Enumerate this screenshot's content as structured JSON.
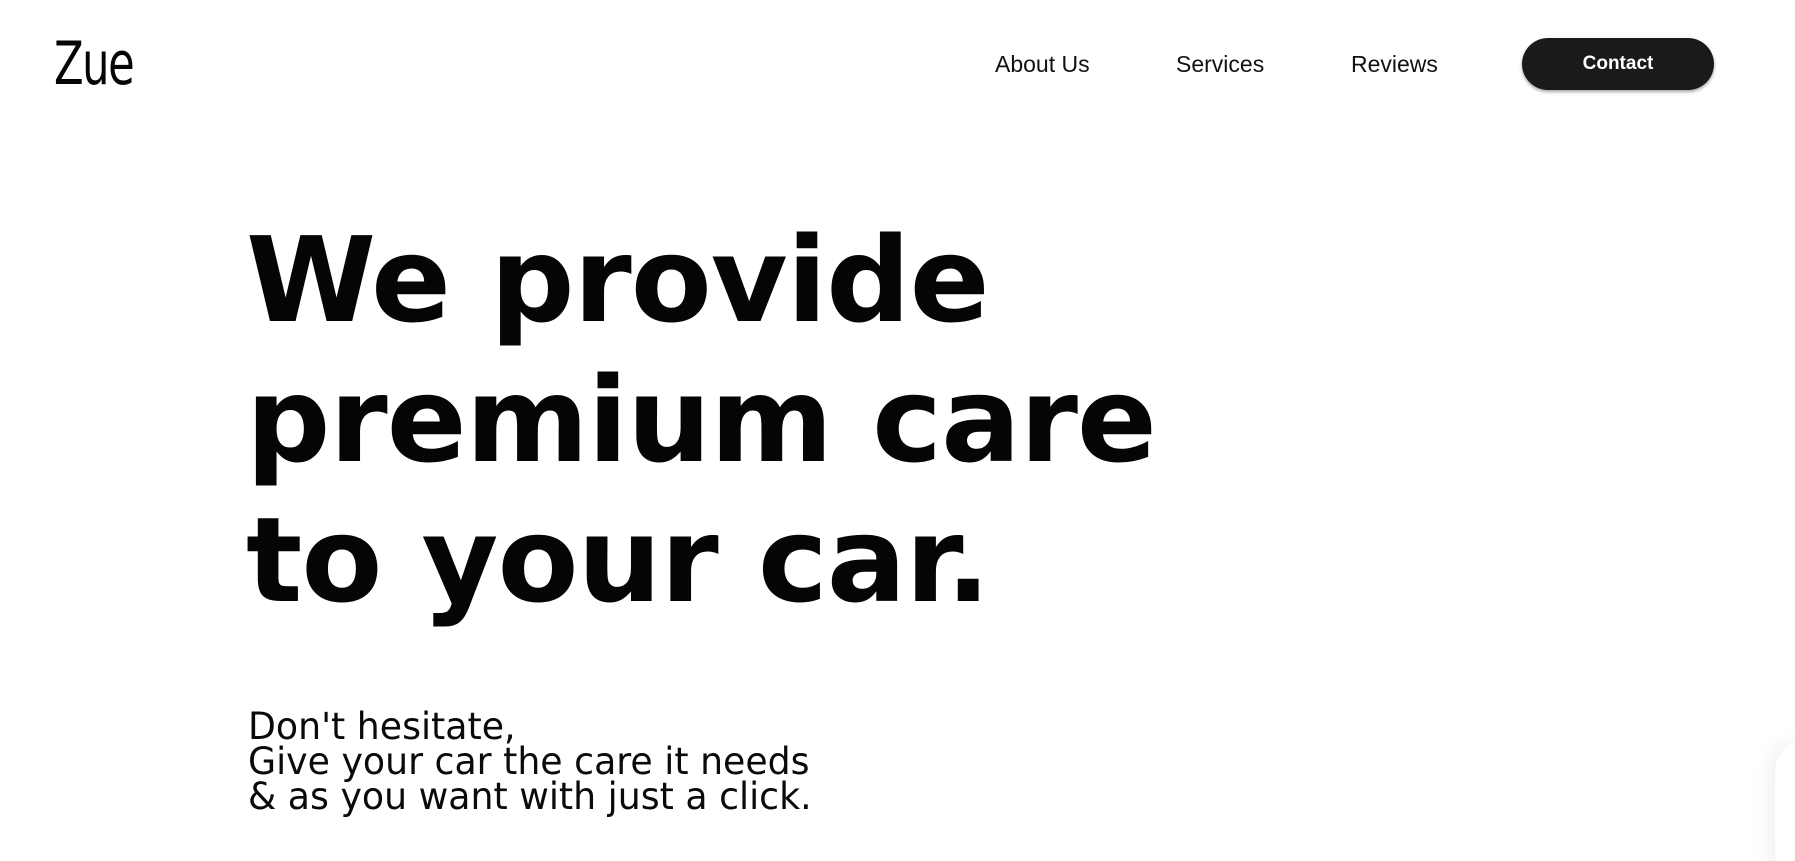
{
  "header": {
    "logo": "Zue",
    "nav": {
      "about": "About Us",
      "services": "Services",
      "reviews": "Reviews"
    },
    "contact_label": "Contact"
  },
  "hero": {
    "title_lines": [
      "We provide",
      "premium care",
      "to your car."
    ],
    "subtitle_lines": [
      "Don't hesitate,",
      "Give your car the care it needs",
      "& as you want with just a click."
    ]
  },
  "colors": {
    "background": "#ffffff",
    "text": "#050505",
    "button_bg": "#1a1a1a",
    "button_text": "#ffffff"
  }
}
